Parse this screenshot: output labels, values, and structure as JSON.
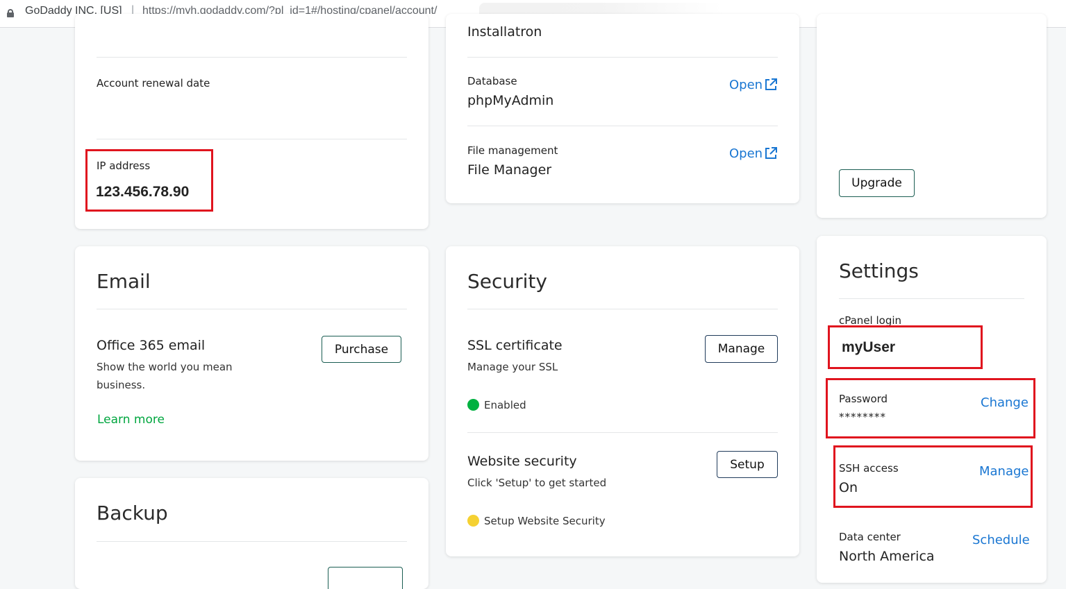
{
  "browser": {
    "site_identity": "GoDaddy INC. [US]",
    "separator": "|",
    "url": "https://myh.godaddy.com/?pl_id=1#/hosting/cpanel/account/"
  },
  "account_card": {
    "renewal_label": "Account renewal date",
    "ip_label": "IP address",
    "ip_value": "123.456.78.90"
  },
  "tools_card": {
    "top_value": "Installatron",
    "rows": [
      {
        "label": "Database",
        "value": "phpMyAdmin",
        "action": "Open"
      },
      {
        "label": "File management",
        "value": "File Manager",
        "action": "Open"
      }
    ]
  },
  "plan_card": {
    "upgrade_label": "Upgrade"
  },
  "email_card": {
    "title": "Email",
    "product_title": "Office 365 email",
    "description_line1": "Show the world you mean",
    "description_line2": "business.",
    "purchase_label": "Purchase",
    "learn_more_label": "Learn more"
  },
  "security_card": {
    "title": "Security",
    "ssl": {
      "title": "SSL certificate",
      "subtitle": "Manage your SSL",
      "button": "Manage",
      "status": "Enabled",
      "status_color": "#00a63f"
    },
    "website_security": {
      "title": "Website security",
      "subtitle": "Click 'Setup' to get started",
      "button": "Setup",
      "status": "Setup Website Security",
      "status_color": "#f5d132"
    }
  },
  "backup_card": {
    "title": "Backup"
  },
  "settings_card": {
    "title": "Settings",
    "cpanel_login_label": "cPanel login",
    "cpanel_login_value": "myUser",
    "password_label": "Password",
    "password_value": "********",
    "password_action": "Change",
    "ssh_label": "SSH access",
    "ssh_value": "On",
    "ssh_action": "Manage",
    "datacenter_label": "Data center",
    "datacenter_value": "North America",
    "datacenter_action": "Schedule"
  },
  "colors": {
    "link_blue": "#1976d2",
    "highlight_red": "#e0141e",
    "learn_more_green": "#00a63f"
  }
}
